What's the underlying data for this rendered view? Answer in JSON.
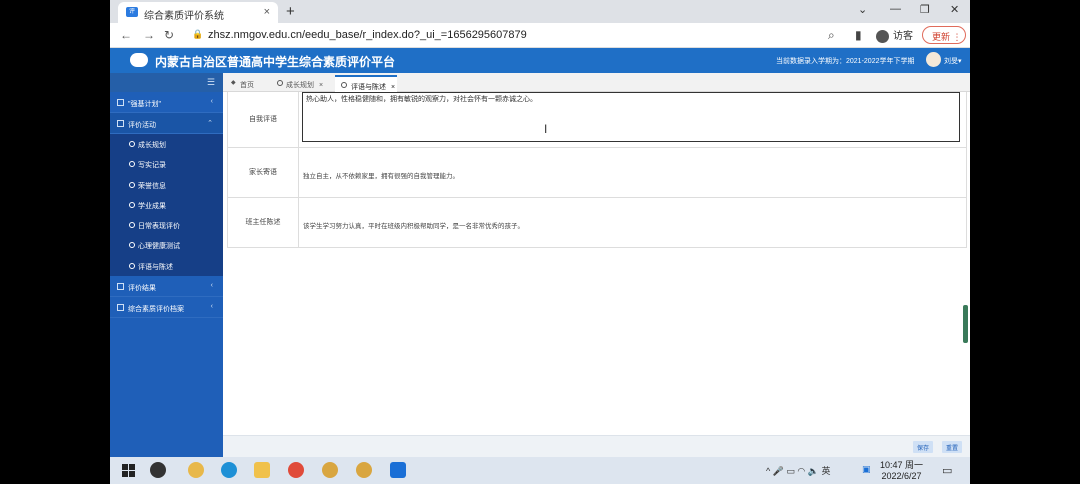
{
  "browser": {
    "tab_title": "综合素质评价系统",
    "tab_close": "×",
    "new_tab": "+",
    "url": "zhsz.nmgov.edu.cn/eedu_base/r_index.do?_ui_=1656295607879",
    "guest_label": "访客",
    "update_label": "更新",
    "back": "←",
    "forward": "→",
    "reload": "↻",
    "lock": "🔒",
    "search_icon": "⌕",
    "sidepanel_icon": "▮",
    "menu": "⋮",
    "win_chevron": "⌄",
    "win_min": "—",
    "win_restore": "❐",
    "win_close": "✕"
  },
  "app": {
    "title": "内蒙古自治区普通高中学生综合素质评价平台",
    "term_info": "当前数据录入学期为：2021-2022学年下学期",
    "user_name": "刘旻▾"
  },
  "sidebar": {
    "toggle_icon": "☰",
    "items": [
      {
        "label": "\"强基计划\"",
        "chevron": "‹"
      },
      {
        "label": "评价活动",
        "chevron": "⌃"
      }
    ],
    "sub_items": [
      "成长规划",
      "写实记录",
      "荣誉信息",
      "学业成果",
      "日常表现评价",
      "心理健康测试",
      "评语与陈述"
    ],
    "bottom_items": [
      {
        "label": "评价结果",
        "chevron": "‹"
      },
      {
        "label": "综合素质评价档案",
        "chevron": "‹"
      }
    ]
  },
  "content_tabs": [
    {
      "label": "首页",
      "icon": "◆"
    },
    {
      "label": "成长规划",
      "close": "×"
    },
    {
      "label": "评语与陈述",
      "close": "×"
    }
  ],
  "form": {
    "rows": [
      {
        "label": "自我评语",
        "value": "热心助人，性格稳健随和，拥有敏锐的观察力，对社会怀有一颗赤诚之心。"
      },
      {
        "label": "家长寄语",
        "value": "独立自主，从不依赖家里，拥有很强的自我管理能力。"
      },
      {
        "label": "班主任陈述",
        "value": "该学生学习努力认真，平时在班级内积极帮助同学，是一名非常优秀的孩子。"
      }
    ],
    "cursor": "I"
  },
  "footer": {
    "save_label": "保存",
    "reset_label": "重置"
  },
  "taskbar": {
    "time": "10:47 周一",
    "date": "2022/6/27",
    "tray": "^ 🎤 ▭ ◠ 🔈 英",
    "notif": "▭"
  },
  "colors": {
    "header_blue": "#1f6fc6",
    "sidebar_blue": "#1f5fb8",
    "submenu_blue": "#163f87"
  }
}
